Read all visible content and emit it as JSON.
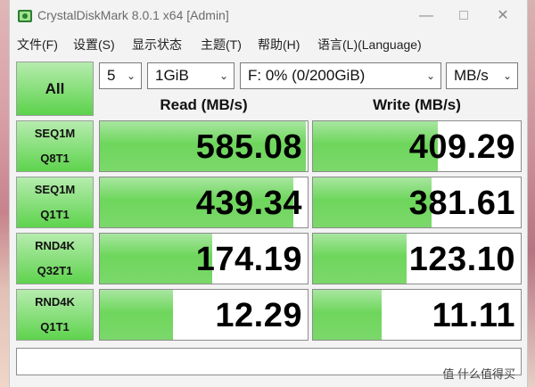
{
  "window": {
    "title": "CrystalDiskMark 8.0.1 x64 [Admin]"
  },
  "menu": [
    "文件(F)",
    "设置(S)",
    "显示状态",
    "主题(T)",
    "帮助(H)",
    "语言(L)(Language)"
  ],
  "controls": {
    "all_label": "All",
    "count": "5",
    "size": "1GiB",
    "drive": "F: 0% (0/200GiB)",
    "unit": "MB/s"
  },
  "headers": {
    "read": "Read (MB/s)",
    "write": "Write (MB/s)"
  },
  "rows": [
    {
      "line1": "SEQ1M",
      "line2": "Q8T1",
      "read": "585.08",
      "write": "409.29",
      "read_fill": 0.99,
      "write_fill": 0.6
    },
    {
      "line1": "SEQ1M",
      "line2": "Q1T1",
      "read": "439.34",
      "write": "381.61",
      "read_fill": 0.93,
      "write_fill": 0.57
    },
    {
      "line1": "RND4K",
      "line2": "Q32T1",
      "read": "174.19",
      "write": "123.10",
      "read_fill": 0.54,
      "write_fill": 0.45
    },
    {
      "line1": "RND4K",
      "line2": "Q1T1",
      "read": "12.29",
      "write": "11.11",
      "read_fill": 0.35,
      "write_fill": 0.33
    }
  ],
  "status_text": "",
  "watermark": "值 什么值得买",
  "colors": {
    "bar_green": "#6ed65c",
    "button_green": "#5cd24b"
  }
}
